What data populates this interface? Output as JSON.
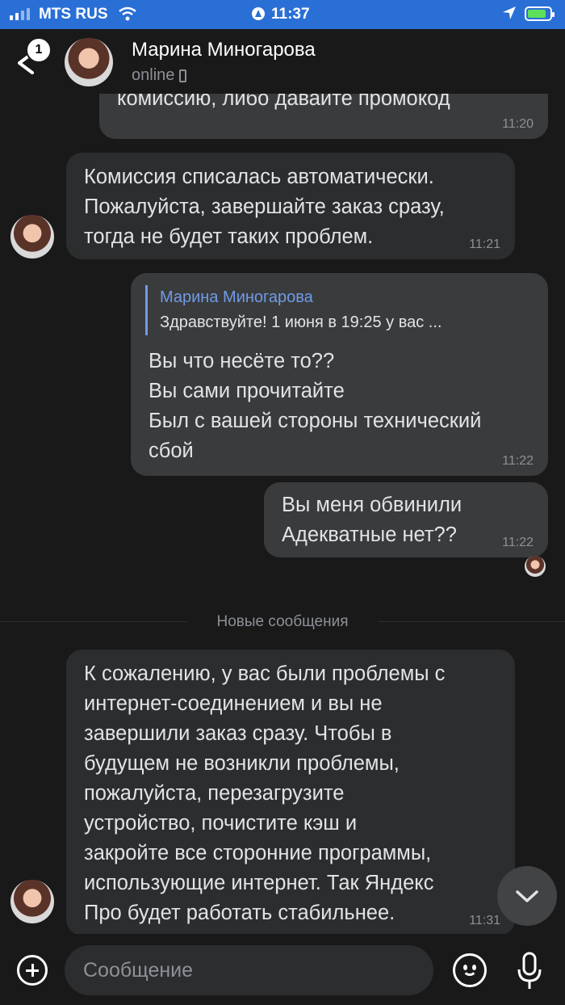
{
  "status_bar": {
    "carrier": "MTS RUS",
    "time": "11:37"
  },
  "header": {
    "back_badge": "1",
    "contact_name": "Марина Миногарова",
    "status": "online"
  },
  "messages": [
    {
      "direction": "out",
      "text": "комиссию, либо давайте промокод",
      "time": "11:20"
    },
    {
      "direction": "in",
      "lines": [
        "Комиссия списалась автоматически.",
        "Пожалуйста, завершайте заказ сразу,",
        "тогда не будет таких проблем."
      ],
      "time": "11:21"
    },
    {
      "direction": "out",
      "reply": {
        "author": "Марина Миногарова",
        "text": "Здравствуйте! 1 июня в 19:25 у вас ..."
      },
      "lines": [
        "Вы что несёте то??",
        "Вы сами прочитайте",
        "Был с вашей стороны технический",
        "сбой"
      ],
      "time": "11:22"
    },
    {
      "direction": "out",
      "lines": [
        "Вы меня обвинили",
        "Адекватные нет??"
      ],
      "time": "11:22"
    },
    {
      "direction": "in",
      "lines": [
        "К сожалению, у вас были проблемы с",
        "интернет-соединением и вы не",
        "завершили заказ сразу. Чтобы в",
        "будущем не возникли проблемы,",
        "пожалуйста, перезагрузите",
        "устройство, почистите кэш и",
        "закройте все сторонние программы,",
        "использующие интернет. Так Яндекс",
        "Про будет работать стабильнее."
      ],
      "time": "11:31"
    }
  ],
  "divider_label": "Новые сообщения",
  "composer": {
    "placeholder": "Сообщение"
  },
  "colors": {
    "background": "#19191a",
    "status_bar": "#2a6fd6",
    "bubble_in": "#2c2d2e",
    "bubble_out": "#3a3b3c",
    "reply_accent": "#6f9be8"
  }
}
